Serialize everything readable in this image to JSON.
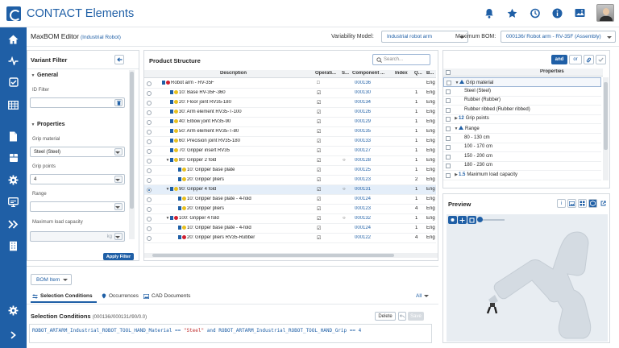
{
  "app": {
    "title": "CONTACT Elements"
  },
  "colors": {
    "brand": "#1f5fa6",
    "status_red": "#d02030",
    "status_yellow": "#e8c020",
    "status_blue": "#1f5fa6"
  },
  "header": {
    "title": "MaxBOM Editor",
    "subtitle": "(Industrial Robot)",
    "variability_label": "Variability Model:",
    "variability_value": "Industrial robot arm",
    "maxbom_label": "Maximum BOM:",
    "maxbom_value": "000136/ Robot arm - RV-35F (Assembly)"
  },
  "topicons": [
    "bell-icon",
    "star-icon",
    "history-icon",
    "info-icon",
    "image-upload-icon"
  ],
  "nav": [
    "home-icon",
    "activity-icon",
    "check-icon",
    "table-icon",
    "document-icon",
    "package-icon",
    "gear-icon",
    "monitor-icon",
    "chevrons-right-icon",
    "building-icon",
    "settings-icon",
    "expand-icon"
  ],
  "variant_filter": {
    "title": "Variant Filter",
    "general_label": "General",
    "id_filter_label": "ID Filter",
    "properties_label": "Properties",
    "fields": [
      {
        "label": "Grip material",
        "value": "Steel (Steel)"
      },
      {
        "label": "Grip points",
        "value": "4"
      },
      {
        "label": "Range",
        "value": ""
      },
      {
        "label": "Maximum load capacity",
        "value": "",
        "unit": "kg"
      }
    ],
    "apply_label": "Apply Filter"
  },
  "product_structure": {
    "title": "Product Structure",
    "search_placeholder": "Search...",
    "columns": [
      "Description",
      "Operati...",
      "S...",
      "Component ...",
      "Index",
      "Q...",
      "B..."
    ],
    "rows": [
      {
        "level": 0,
        "toggle": "",
        "status": "red",
        "desc": "Robot arm - RV-35F",
        "op": "□",
        "s": "",
        "comp": "000136",
        "idx": "",
        "q": "",
        "b": "Eng"
      },
      {
        "level": 1,
        "toggle": "",
        "status": "yellow",
        "desc": "10: Base RV-35F-360",
        "op": "☑",
        "s": "",
        "comp": "000130",
        "idx": "",
        "q": "1",
        "b": "Eng"
      },
      {
        "level": 1,
        "toggle": "",
        "status": "yellow",
        "desc": "20: Floor joint RV35-180",
        "op": "☑",
        "s": "",
        "comp": "000134",
        "idx": "",
        "q": "1",
        "b": "Eng"
      },
      {
        "level": 1,
        "toggle": "",
        "status": "yellow",
        "desc": "30: Arm element RV35-T-100",
        "op": "☑",
        "s": "",
        "comp": "000126",
        "idx": "",
        "q": "1",
        "b": "Eng"
      },
      {
        "level": 1,
        "toggle": "",
        "status": "yellow",
        "desc": "40: Elbow joint RV35-90",
        "op": "☑",
        "s": "",
        "comp": "000129",
        "idx": "",
        "q": "1",
        "b": "Eng"
      },
      {
        "level": 1,
        "toggle": "",
        "status": "yellow",
        "desc": "50: Arm element RV35-T-80",
        "op": "☑",
        "s": "",
        "comp": "000135",
        "idx": "",
        "q": "1",
        "b": "Eng"
      },
      {
        "level": 1,
        "toggle": "",
        "status": "yellow",
        "desc": "60: Precision joint RV35-180",
        "op": "☑",
        "s": "",
        "comp": "000133",
        "idx": "",
        "q": "1",
        "b": "Eng"
      },
      {
        "level": 1,
        "toggle": "",
        "status": "yellow",
        "desc": "70: Gripper insert RV35",
        "op": "☑",
        "s": "",
        "comp": "000127",
        "idx": "",
        "q": "1",
        "b": "Eng"
      },
      {
        "level": 1,
        "toggle": "▼",
        "status": "yellow",
        "desc": "80: Gripper 2 fold",
        "op": "☑",
        "s": "○",
        "comp": "000128",
        "idx": "",
        "q": "1",
        "b": "Eng"
      },
      {
        "level": 2,
        "toggle": "",
        "status": "yellow",
        "desc": "10: Gripper base plate",
        "op": "☑",
        "s": "",
        "comp": "000125",
        "idx": "",
        "q": "1",
        "b": "Eng"
      },
      {
        "level": 2,
        "toggle": "",
        "status": "yellow",
        "desc": "20: Gripper pliers",
        "op": "☑",
        "s": "",
        "comp": "000123",
        "idx": "",
        "q": "2",
        "b": "Eng"
      },
      {
        "level": 1,
        "toggle": "▼",
        "status": "yellow",
        "desc": "90: Gripper 4 fold",
        "op": "☑",
        "s": "○",
        "comp": "000131",
        "idx": "",
        "q": "1",
        "b": "Eng",
        "selected": true
      },
      {
        "level": 2,
        "toggle": "",
        "status": "yellow",
        "desc": "10: Gripper base plate - 4-fold",
        "op": "☑",
        "s": "",
        "comp": "000124",
        "idx": "",
        "q": "1",
        "b": "Eng"
      },
      {
        "level": 2,
        "toggle": "",
        "status": "yellow",
        "desc": "20: Gripper pliers",
        "op": "☑",
        "s": "",
        "comp": "000123",
        "idx": "",
        "q": "4",
        "b": "Eng"
      },
      {
        "level": 1,
        "toggle": "▼",
        "status": "red",
        "desc": "100: Gripper 4 fold",
        "op": "☑",
        "s": "○",
        "comp": "000132",
        "idx": "",
        "q": "1",
        "b": "Eng"
      },
      {
        "level": 2,
        "toggle": "",
        "status": "yellow",
        "desc": "10: Gripper base plate - 4-fold",
        "op": "☑",
        "s": "",
        "comp": "000124",
        "idx": "",
        "q": "1",
        "b": "Eng"
      },
      {
        "level": 2,
        "toggle": "",
        "status": "red",
        "desc": "20: Gripper pliers RV35-Rubber",
        "op": "☑",
        "s": "",
        "comp": "000122",
        "idx": "",
        "q": "4",
        "b": "Eng"
      }
    ]
  },
  "properties": {
    "and_label": "and",
    "or_label": "or",
    "header": "Properties",
    "rows": [
      {
        "level": 0,
        "toggle": "▼",
        "icon": "triangle",
        "text": "Grip material",
        "selected": true
      },
      {
        "level": 1,
        "text": "Steel (Steel)"
      },
      {
        "level": 1,
        "text": "Rubber (Rubber)"
      },
      {
        "level": 1,
        "text": "Rubber ribbed (Rubber ribbed)"
      },
      {
        "level": 0,
        "toggle": "▶",
        "icon": "12",
        "text": "Grip points"
      },
      {
        "level": 0,
        "toggle": "▼",
        "icon": "triangle",
        "text": "Range"
      },
      {
        "level": 1,
        "text": "80 - 130 cm"
      },
      {
        "level": 1,
        "text": "100 - 170 cm"
      },
      {
        "level": 1,
        "text": "150 - 200 cm"
      },
      {
        "level": 1,
        "text": "180 - 230 cm"
      },
      {
        "level": 0,
        "toggle": "▶",
        "icon": "1.5",
        "text": "Maximum load capacity"
      }
    ]
  },
  "preview": {
    "title": "Preview"
  },
  "bottom": {
    "dropdown_label": "BOM Item",
    "tabs": [
      "Selection Conditions",
      "Occurrences",
      "CAD Documents"
    ],
    "filter_label": "All",
    "section_title": "Selection Conditions",
    "section_path": "(000136//000131//90/0.0)",
    "delete_label": "Delete",
    "save_label": "Save",
    "code_pre": "ROBOT_ARTARM_Industrial_ROBOT_TOOL_HAND_Material == ",
    "code_str": "\"Steel\"",
    "code_post": " and ROBOT_ARTARM_Industrial_ROBOT_TOOL_HAND_Grip == 4"
  }
}
